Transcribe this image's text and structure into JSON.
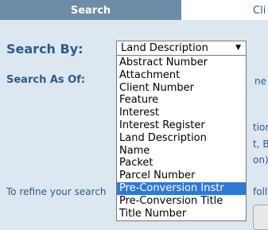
{
  "tabs": {
    "search": "Search",
    "client_fragment": "Cli"
  },
  "labels": {
    "search_by": "Search By:",
    "search_as_of": "Search As Of:",
    "refine_prefix": "To refine your search",
    "refine_suffix": "foll"
  },
  "partial_text": {
    "as_of_right": "ne",
    "tion": "tion",
    "bl": "t, Bl",
    "on": "on)"
  },
  "select": {
    "value": "Land Description",
    "arrow_icon": "dropdown-arrow-icon",
    "options": [
      "Abstract Number",
      "Attachment",
      "Client Number",
      "Feature",
      "Interest",
      "Interest Register",
      "Land Description",
      "Name",
      "Packet",
      "Parcel Number",
      "Pre-Conversion Instr",
      "Pre-Conversion Title",
      "Title Number"
    ],
    "highlighted": "Pre-Conversion Instr"
  },
  "colors": {
    "background": "#dde7ef",
    "tab_active": "#6d8ca8",
    "label": "#2a5c8e",
    "highlight": "#2f79d6"
  }
}
